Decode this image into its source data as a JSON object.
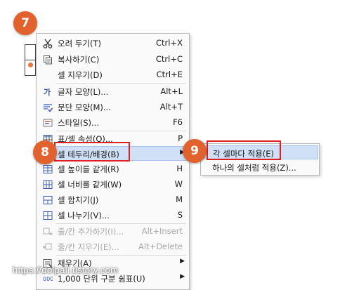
{
  "badges": {
    "step7": "7",
    "step8": "8",
    "step9": "9"
  },
  "menu": {
    "items": [
      {
        "label": "오려 두기(T)",
        "shortcut": "Ctrl+X",
        "icon": "scissors-icon"
      },
      {
        "label": "복사하기(C)",
        "shortcut": "Ctrl+C",
        "icon": "copy-icon"
      },
      {
        "label": "셀 지우기(D)",
        "shortcut": "Ctrl+E",
        "icon": ""
      },
      {
        "label": "글자 모양(L)...",
        "shortcut": "Alt+L",
        "icon": "char-shape-icon"
      },
      {
        "label": "문단 모양(M)...",
        "shortcut": "Alt+T",
        "icon": "paragraph-shape-icon"
      },
      {
        "label": "스타일(S)...",
        "shortcut": "F6",
        "icon": "style-icon"
      },
      {
        "label": "표/셀 속성(Q)...",
        "shortcut": "P",
        "icon": "table-properties-icon"
      },
      {
        "label": "셀 테두리/배경(B)",
        "shortcut": "",
        "icon": "cell-border-icon"
      },
      {
        "label": "셀 높이를 같게(R)",
        "shortcut": "H",
        "icon": "equal-height-icon"
      },
      {
        "label": "셀 너비를 같게(W)",
        "shortcut": "W",
        "icon": "equal-width-icon"
      },
      {
        "label": "셀 합치기(J)",
        "shortcut": "M",
        "icon": "merge-cells-icon"
      },
      {
        "label": "셀 나누기(V)...",
        "shortcut": "S",
        "icon": "split-cells-icon"
      },
      {
        "label": "줄/칸 추가하기(I)...",
        "shortcut": "Alt+Insert",
        "icon": "add-row-col-icon"
      },
      {
        "label": "줄/칸 지우기(E)...",
        "shortcut": "Alt+Delete",
        "icon": "delete-row-col-icon"
      },
      {
        "label": "채우기(A)",
        "shortcut": "",
        "icon": "fill-icon"
      },
      {
        "label": "1,000 단위 구분 쉼표(U)",
        "shortcut": "",
        "icon": "thousands-comma-icon"
      }
    ]
  },
  "submenu": {
    "items": [
      {
        "label": "각 셀마다 적용(E)"
      },
      {
        "label": "하나의 셀처럼 적용(Z)..."
      }
    ]
  },
  "watermark": "https://dolpali.tistory.com",
  "colors": {
    "badge": "#e1622d",
    "highlight": "#cfe0f7",
    "annotation_box": "#e02020"
  }
}
